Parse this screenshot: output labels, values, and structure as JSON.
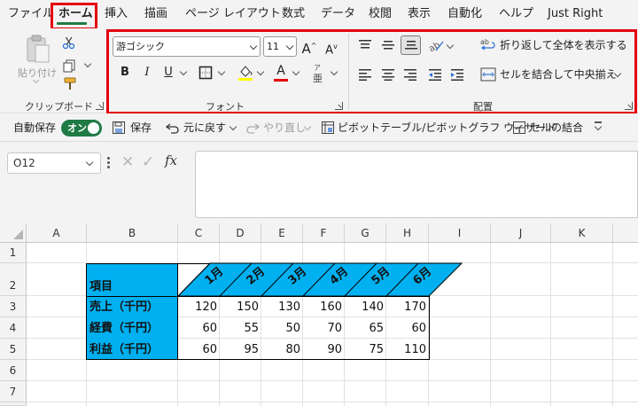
{
  "menu": {
    "tabs": [
      "ファイル",
      "ホーム",
      "挿入",
      "描画",
      "ページ レイアウト",
      "数式",
      "データ",
      "校閲",
      "表示",
      "自動化",
      "ヘルプ",
      "Just Right"
    ]
  },
  "ribbon": {
    "clipboard": {
      "paste_label": "貼り付け",
      "group_label": "クリップボード"
    },
    "font": {
      "font_name": "游ゴシック",
      "font_size": "11",
      "grow_label": "A",
      "shrink_label": "A",
      "bold": "B",
      "italic": "I",
      "underline": "U",
      "font_color_label": "A",
      "phonetic_label": "亜",
      "phonetic_ruby": "ア",
      "group_label": "フォント"
    },
    "alignment": {
      "wrap_text": "折り返して全体を表示する",
      "merge_center": "セルを結合して中央揃え",
      "group_label": "配置"
    }
  },
  "qat": {
    "autosave": "自動保存",
    "toggle_on": "オン",
    "save": "保存",
    "undo": "元に戻す",
    "redo": "やり直し",
    "pivot": "ピボットテーブル/ピボットグラフ ウィザード",
    "merge": "セルの結合"
  },
  "formula_bar": {
    "name_box": "O12",
    "fx": "fx",
    "formula": ""
  },
  "sheet": {
    "columns": [
      "A",
      "B",
      "C",
      "D",
      "E",
      "F",
      "G",
      "H",
      "I",
      "J",
      "K"
    ],
    "rows": [
      "1",
      "2",
      "3",
      "4",
      "5",
      "6",
      "7"
    ],
    "header_label": "項目",
    "months": [
      "1月",
      "2月",
      "3月",
      "4月",
      "5月",
      "6月"
    ],
    "data_rows": [
      {
        "label": "売上（千円）",
        "values": [
          "120",
          "150",
          "130",
          "160",
          "140",
          "170"
        ]
      },
      {
        "label": "経費（千円）",
        "values": [
          "60",
          "55",
          "50",
          "70",
          "65",
          "60"
        ]
      },
      {
        "label": "利益（千円）",
        "values": [
          "60",
          "95",
          "80",
          "90",
          "75",
          "110"
        ]
      }
    ]
  },
  "colors": {
    "table_fill": "#00b0f0",
    "highlight": "#e3000f",
    "accent": "#1f7a45"
  }
}
